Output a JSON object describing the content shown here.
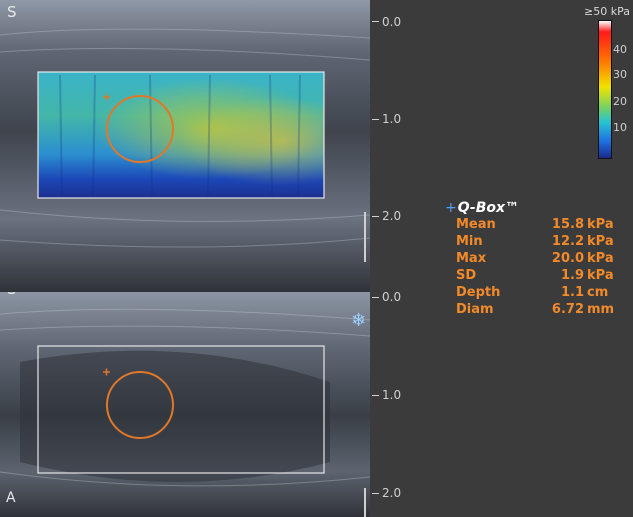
{
  "colorbar": {
    "max_label": "≥50 kPa",
    "ticks": [
      "40",
      "30",
      "20",
      "10"
    ]
  },
  "top_pane": {
    "logo": "S",
    "depth_ticks": [
      "0.0",
      "1.0",
      "2.0"
    ]
  },
  "bottom_pane": {
    "logo": "S",
    "depth_ticks": [
      "0.0",
      "1.0",
      "2.0"
    ],
    "freeze_icon": "snowflake-icon",
    "corner_label": "A"
  },
  "qbox": {
    "title": "Q-Box™",
    "rows": [
      {
        "key": "Mean",
        "value": "15.8",
        "unit": "kPa"
      },
      {
        "key": "Min",
        "value": "12.2",
        "unit": "kPa"
      },
      {
        "key": "Max",
        "value": "20.0",
        "unit": "kPa"
      },
      {
        "key": "SD",
        "value": "1.9",
        "unit": "kPa"
      },
      {
        "key": "Depth",
        "value": "1.1",
        "unit": "cm"
      },
      {
        "key": "Diam",
        "value": "6.72",
        "unit": "mm"
      }
    ]
  },
  "colors": {
    "background": "#3b3b3b",
    "qbox_text": "#f28a2a",
    "roi_circle": "#e0782a",
    "box_outline": "#e6e6e6"
  }
}
